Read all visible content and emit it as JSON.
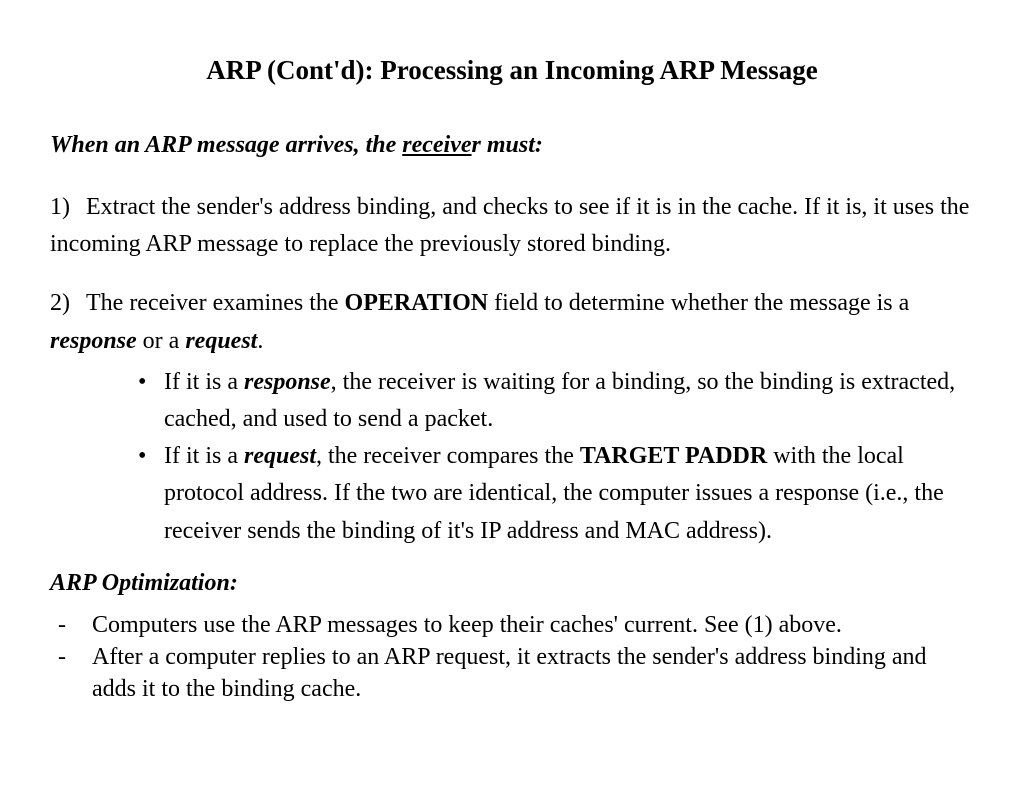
{
  "title": "ARP (Cont'd): Processing an Incoming ARP Message",
  "intro": {
    "prefix": "When an ARP message arrives, the ",
    "underlined": "receive",
    "suffix": "r must:"
  },
  "item1": {
    "num": "1)",
    "text": "Extract the sender's address binding, and checks to see if it is in the cache. If it is, it uses the incoming ARP message to replace the previously stored binding."
  },
  "item2": {
    "num": "2)",
    "t1": "The receiver examines the ",
    "bold1": "OPERATION",
    "t2": " field to determine whether the message is a ",
    "ib1": "response",
    "t3": " or a ",
    "ib2": "request",
    "t4": "."
  },
  "bullets": [
    {
      "t1": "If it is a ",
      "ib": "response",
      "t2": ", the receiver is waiting for a binding, so the binding is extracted, cached, and used to send a packet."
    },
    {
      "t1": "If it is a ",
      "ib": "request",
      "t2": ", the receiver compares the ",
      "bold": "TARGET PADDR",
      "t3": " with the local protocol address. If the two are identical, the computer issues a response (i.e., the receiver sends the binding of it's IP address and MAC address)."
    }
  ],
  "subhead": "ARP Optimization:",
  "dashes": [
    "Computers use the ARP messages to keep their caches' current. See (1) above.",
    "After a computer replies to an ARP request, it extracts the sender's address binding and adds it to the binding cache."
  ]
}
